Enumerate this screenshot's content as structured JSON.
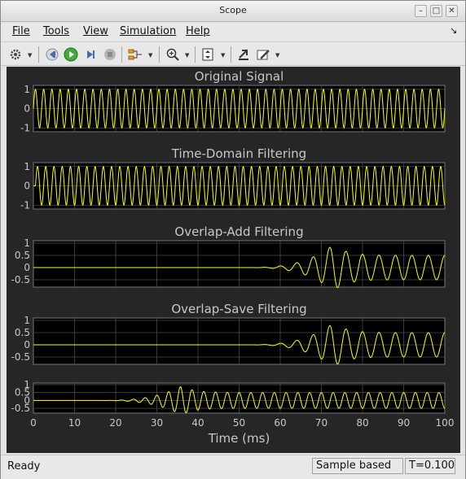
{
  "window": {
    "title": "Scope"
  },
  "menu": [
    "File",
    "Tools",
    "View",
    "Simulation",
    "Help"
  ],
  "toolbar_icons": [
    "gear-icon",
    "step-back-icon",
    "run-icon",
    "step-forward-icon",
    "stop-icon",
    "signal-select-icon",
    "zoom-in-icon",
    "fit-axes-icon",
    "restore-icon",
    "style-icon"
  ],
  "status": {
    "left": "Ready",
    "mode": "Sample based",
    "time": "T=0.100"
  },
  "colors": {
    "background": "#262626",
    "axes_bg": "#000000",
    "trace": "#ffff00",
    "grid": "#4a4a4a",
    "text": "#c8c8c8"
  },
  "chart_data": [
    {
      "type": "line",
      "title": "Original Signal",
      "ylim": [
        -1.2,
        1.2
      ],
      "yticks": [
        "1",
        "0",
        "-1"
      ],
      "yvalues": [
        1,
        0,
        -1
      ],
      "xlim": [
        0,
        100
      ],
      "series": [
        {
          "signal": "sine",
          "frequency_hz": 500,
          "amplitude": 1,
          "onset_ms": 0
        }
      ]
    },
    {
      "type": "line",
      "title": "Time-Domain Filtering",
      "ylim": [
        -1.2,
        1.2
      ],
      "yticks": [
        "1",
        "0",
        "-1"
      ],
      "yvalues": [
        1,
        0,
        -1
      ],
      "xlim": [
        0,
        100
      ],
      "series": [
        {
          "signal": "filtered sine",
          "frequency_hz": 500,
          "amplitude": 1,
          "onset_ms": 0.5
        }
      ]
    },
    {
      "type": "line",
      "title": "Overlap-Add Filtering",
      "ylim": [
        -0.8,
        1.1
      ],
      "yticks": [
        "1",
        "0.5",
        "0",
        "-0.5"
      ],
      "yvalues": [
        1,
        0.5,
        0,
        -0.5
      ],
      "xlim": [
        0,
        100
      ],
      "series": [
        {
          "signal": "filtered sine",
          "frequency_hz": 250,
          "amplitude": 0.5,
          "onset_ms": 51,
          "peak": 0.95,
          "peak_ms": 73
        }
      ]
    },
    {
      "type": "line",
      "title": "Overlap-Save Filtering",
      "ylim": [
        -0.8,
        1.1
      ],
      "yticks": [
        "1",
        "0.5",
        "0",
        "-0.5"
      ],
      "yvalues": [
        1,
        0.5,
        0,
        -0.5
      ],
      "xlim": [
        0,
        100
      ],
      "series": [
        {
          "signal": "filtered sine",
          "frequency_hz": 250,
          "amplitude": 0.5,
          "onset_ms": 51,
          "peak": 0.9,
          "peak_ms": 73
        }
      ]
    },
    {
      "type": "line",
      "title": "",
      "ylim": [
        -0.8,
        1.1
      ],
      "yticks": [
        "1",
        "0.5",
        "0",
        "-0.5"
      ],
      "yvalues": [
        1,
        0.5,
        0,
        -0.5
      ],
      "xlim": [
        0,
        100
      ],
      "xticks": [
        "0",
        "10",
        "20",
        "30",
        "40",
        "50",
        "60",
        "70",
        "80",
        "90",
        "100"
      ],
      "xlabel": "Time (ms)",
      "series": [
        {
          "signal": "filtered sine",
          "frequency_hz": 350,
          "amplitude": 0.5,
          "onset_ms": 15,
          "peak": 0.9,
          "peak_ms": 36
        }
      ]
    }
  ]
}
